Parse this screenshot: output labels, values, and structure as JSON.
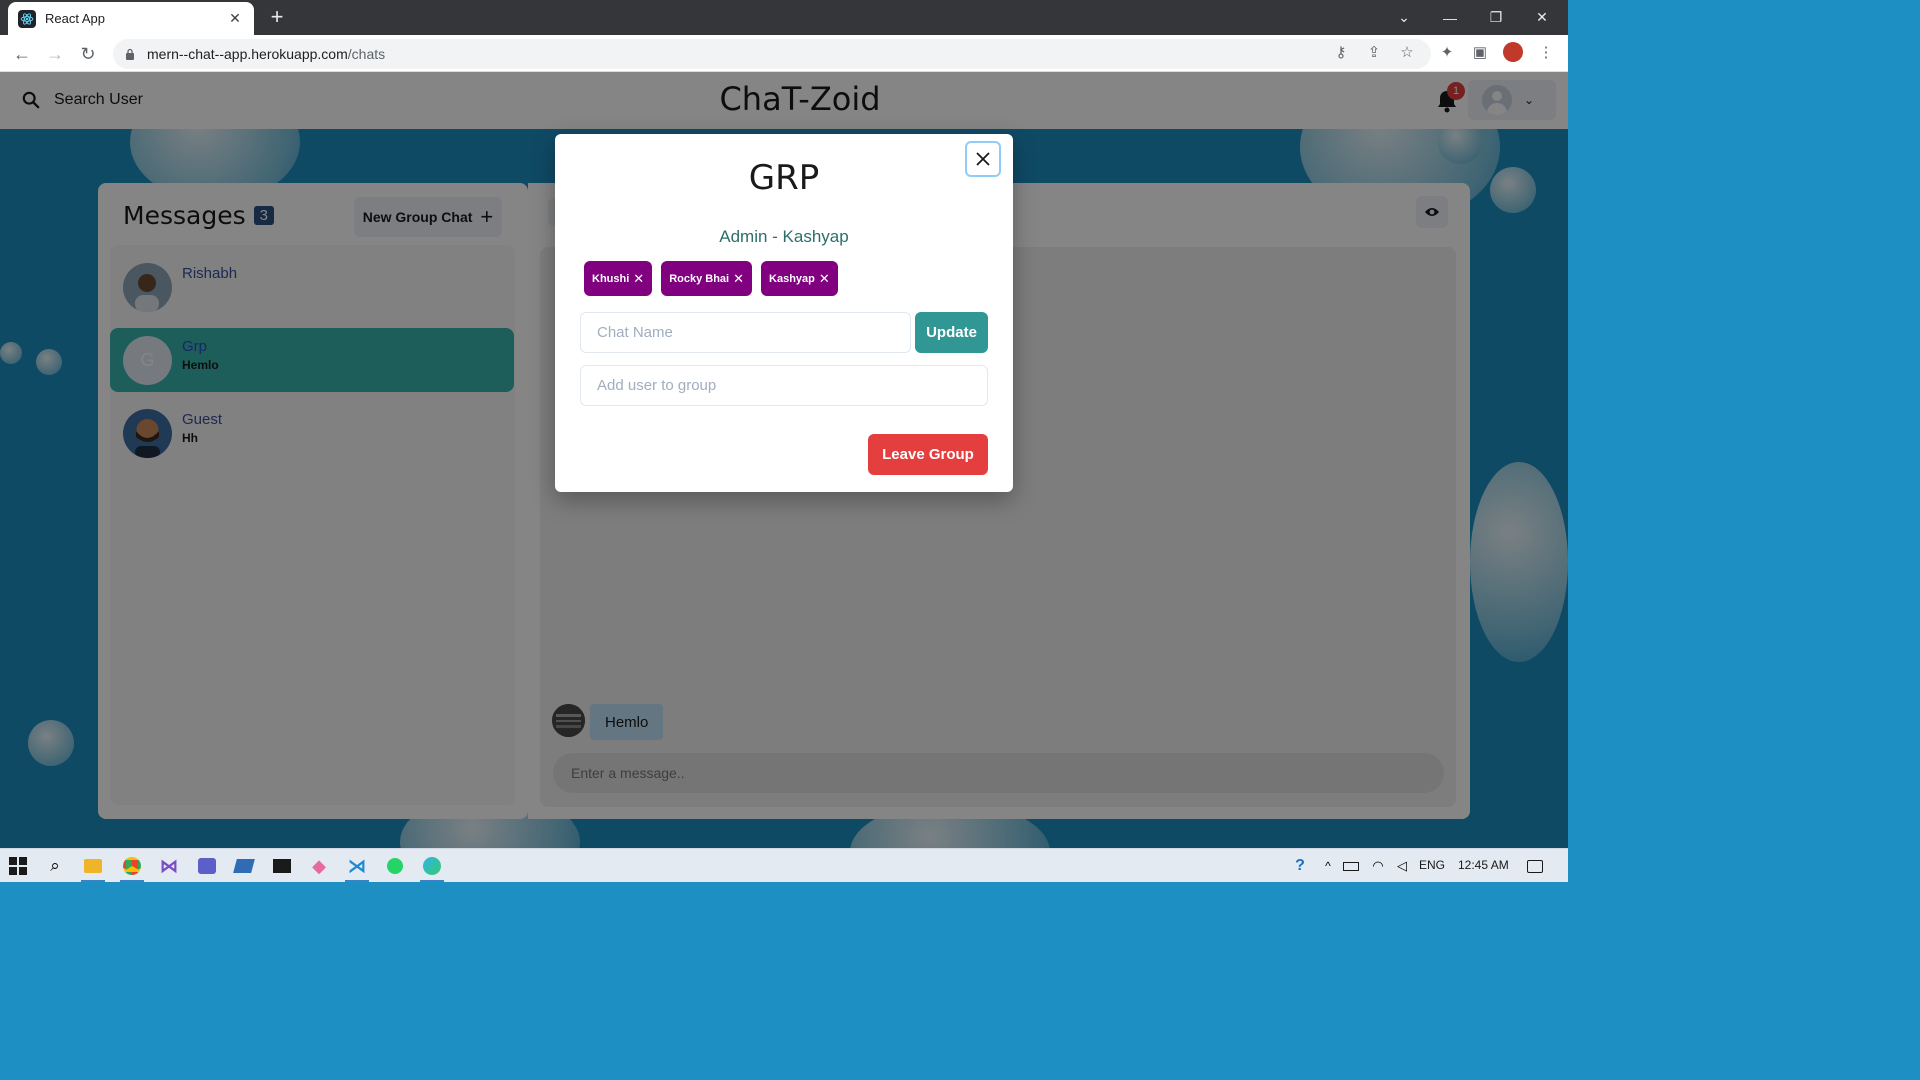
{
  "browser": {
    "tab_title": "React App",
    "new_tab": "+",
    "url_host": "mern--chat--app.herokuapp.com",
    "url_path": "/chats"
  },
  "app": {
    "search_label": "Search User",
    "title": "ChaT-Zoid",
    "notification_count": "1"
  },
  "sidebar": {
    "title": "Messages",
    "count": "3",
    "new_group_label": "New Group Chat",
    "chats": [
      {
        "name": "Rishabh",
        "last": ""
      },
      {
        "name": "Grp",
        "last": "Hemlo",
        "initial": "G"
      },
      {
        "name": "Guest",
        "last": "Hh"
      }
    ]
  },
  "chat": {
    "message_text": "Hemlo",
    "input_placeholder": "Enter a message.."
  },
  "modal": {
    "title": "GRP",
    "admin_line": "Admin - Kashyap",
    "members": [
      "Khushi",
      "Rocky Bhai",
      "Kashyap"
    ],
    "chat_name_placeholder": "Chat Name",
    "update_label": "Update",
    "add_user_placeholder": "Add user to group",
    "leave_label": "Leave Group"
  },
  "taskbar": {
    "language": "ENG",
    "time": "12:45 AM"
  },
  "colors": {
    "accent_teal": "#38B2AC",
    "tag_purple": "#800080",
    "danger_red": "#E53E3E",
    "update_teal": "#319795"
  }
}
